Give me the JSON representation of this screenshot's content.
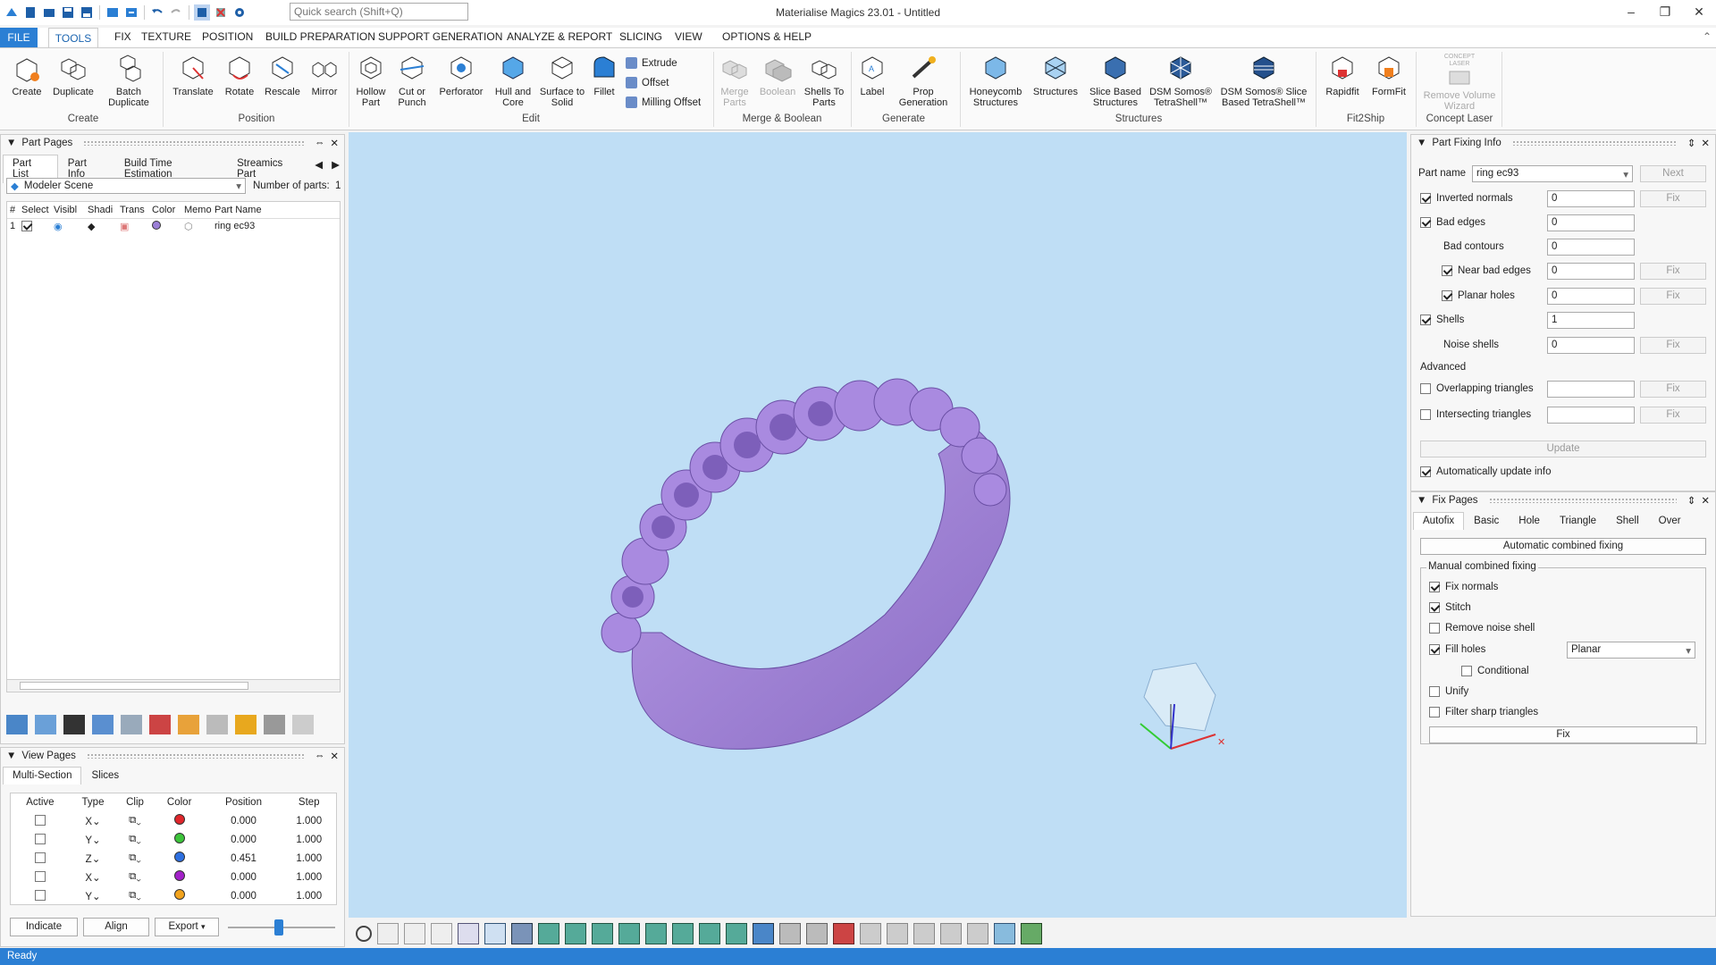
{
  "window": {
    "title": "Materialise Magics 23.01 - Untitled",
    "search_placeholder": "Quick search (Shift+Q)"
  },
  "menu": {
    "file": "FILE",
    "tools": "TOOLS",
    "items": [
      "FIX",
      "TEXTURE",
      "POSITION",
      "BUILD PREPARATION",
      "SUPPORT GENERATION",
      "ANALYZE & REPORT",
      "SLICING",
      "VIEW",
      "OPTIONS & HELP"
    ]
  },
  "ribbon": {
    "create": {
      "create": "Create",
      "duplicate": "Duplicate",
      "batch": "Batch Duplicate",
      "group": "Create"
    },
    "position": {
      "translate": "Translate",
      "rotate": "Rotate",
      "rescale": "Rescale",
      "mirror": "Mirror",
      "group": "Position"
    },
    "edit": {
      "hollow": "Hollow Part",
      "cut": "Cut or Punch",
      "perforator": "Perforator",
      "hull": "Hull and Core",
      "surface": "Surface to Solid",
      "fillet": "Fillet",
      "extrude": "Extrude",
      "offset": "Offset",
      "milling": "Milling Offset",
      "group": "Edit"
    },
    "merge": {
      "merge": "Merge Parts",
      "boolean": "Boolean",
      "shells": "Shells To Parts",
      "group": "Merge & Boolean"
    },
    "generate": {
      "label": "Label",
      "prop": "Prop Generation",
      "group": "Generate"
    },
    "structures": {
      "honeycomb": "Honeycomb Structures",
      "structures": "Structures",
      "slice": "Slice Based Structures",
      "dsm1": "DSM Somos® TetraShell™",
      "dsm2": "DSM Somos® Slice Based TetraShell™",
      "group": "Structures"
    },
    "fit2ship": {
      "rapidfit": "Rapidfit",
      "formfit": "FormFit",
      "group": "Fit2Ship"
    },
    "concept": {
      "top": "CONCEPT LASER",
      "remove": "Remove Volume Wizard",
      "group": "Concept Laser"
    }
  },
  "part_pages": {
    "title": "Part Pages",
    "tabs": [
      "Part List",
      "Part Info",
      "Build Time Estimation",
      "Streamics Part"
    ],
    "scene": "Modeler Scene",
    "num_parts_label": "Number of parts:",
    "num_parts": "1",
    "columns": [
      "#",
      "Select",
      "Visibl",
      "Shadi",
      "Trans",
      "Color",
      "Memo",
      "Part Name"
    ],
    "rows": [
      {
        "n": "1",
        "name": "ring ec93"
      }
    ]
  },
  "view_pages": {
    "title": "View Pages",
    "tabs": [
      "Multi-Section",
      "Slices"
    ],
    "columns": [
      "Active",
      "Type",
      "Clip",
      "Color",
      "Position",
      "Step"
    ],
    "rows": [
      {
        "type": "X",
        "color": "#e0262b",
        "pos": "0.000",
        "step": "1.000"
      },
      {
        "type": "Y",
        "color": "#3cc43a",
        "pos": "0.000",
        "step": "1.000"
      },
      {
        "type": "Z",
        "color": "#2d6fe0",
        "pos": "0.451",
        "step": "1.000"
      },
      {
        "type": "X",
        "color": "#a321c9",
        "pos": "0.000",
        "step": "1.000"
      },
      {
        "type": "Y",
        "color": "#f2a31d",
        "pos": "0.000",
        "step": "1.000"
      }
    ],
    "indicate": "Indicate",
    "align": "Align",
    "export": "Export"
  },
  "fixing_info": {
    "title": "Part Fixing Info",
    "part_name_label": "Part name",
    "part_name": "ring ec93",
    "next": "Next",
    "fix": "Fix",
    "inverted": "Inverted normals",
    "inverted_v": "0",
    "bad_edges": "Bad edges",
    "bad_edges_v": "0",
    "bad_contours": "Bad contours",
    "bad_contours_v": "0",
    "near_bad": "Near bad edges",
    "near_bad_v": "0",
    "planar": "Planar holes",
    "planar_v": "0",
    "shells": "Shells",
    "shells_v": "1",
    "noise": "Noise shells",
    "noise_v": "0",
    "advanced": "Advanced",
    "overlap": "Overlapping triangles",
    "intersect": "Intersecting triangles",
    "update": "Update",
    "auto_update": "Automatically update info"
  },
  "fix_pages": {
    "title": "Fix Pages",
    "tabs": [
      "Autofix",
      "Basic",
      "Hole",
      "Triangle",
      "Shell",
      "Over"
    ],
    "auto_combined": "Automatic combined fixing",
    "manual": "Manual combined fixing",
    "fix_normals": "Fix normals",
    "stitch": "Stitch",
    "remove_noise": "Remove noise shell",
    "fill_holes": "Fill holes",
    "fill_mode": "Planar",
    "conditional": "Conditional",
    "unify": "Unify",
    "filter_sharp": "Filter sharp triangles",
    "fix": "Fix"
  },
  "status": "Ready",
  "colors": {
    "accent": "#2b7fd4",
    "viewport": "#bfdef5",
    "part": "#9b7fd6"
  }
}
